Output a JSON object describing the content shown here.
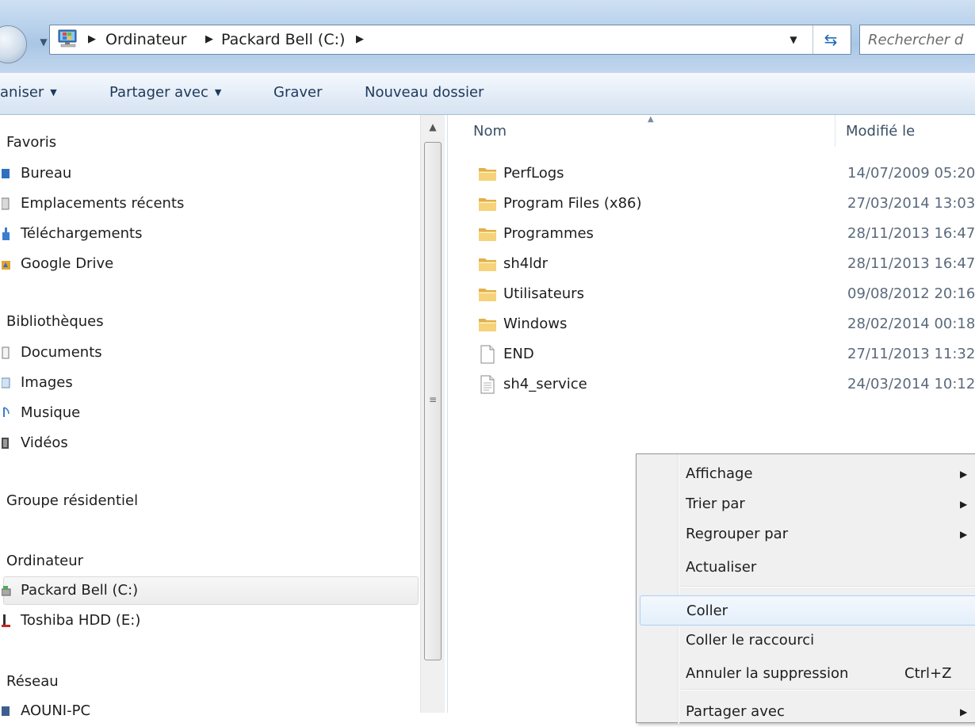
{
  "address_bar": {
    "crumbs": [
      "Ordinateur",
      "Packard Bell (C:)"
    ],
    "search_placeholder": "Rechercher d"
  },
  "toolbar": {
    "organize_label": "aniser",
    "share_label": "Partager avec",
    "burn_label": "Graver",
    "new_folder_label": "Nouveau dossier"
  },
  "nav": {
    "favorites_title": "Favoris",
    "favorites": [
      "Bureau",
      "Emplacements récents",
      "Téléchargements",
      "Google Drive"
    ],
    "libraries_title": "Bibliothèques",
    "libraries": [
      "Documents",
      "Images",
      "Musique",
      "Vidéos"
    ],
    "homegroup_title": "Groupe résidentiel",
    "computer_title": "Ordinateur",
    "drives": [
      "Packard Bell (C:)",
      "Toshiba HDD (E:)"
    ],
    "network_title": "Réseau",
    "network_items": [
      "AOUNI-PC"
    ]
  },
  "columns": {
    "name": "Nom",
    "modified": "Modifié le"
  },
  "files": [
    {
      "name": "PerfLogs",
      "date": "14/07/2009 05:20",
      "type": "folder"
    },
    {
      "name": "Program Files (x86)",
      "date": "27/03/2014 13:03",
      "type": "folder"
    },
    {
      "name": "Programmes",
      "date": "28/11/2013 16:47",
      "type": "folder"
    },
    {
      "name": "sh4ldr",
      "date": "28/11/2013 16:47",
      "type": "folder"
    },
    {
      "name": "Utilisateurs",
      "date": "09/08/2012 20:16",
      "type": "folder"
    },
    {
      "name": "Windows",
      "date": "28/02/2014 00:18",
      "type": "folder"
    },
    {
      "name": "END",
      "date": "27/11/2013 11:32",
      "type": "file"
    },
    {
      "name": "sh4_service",
      "date": "24/03/2014 10:12",
      "type": "textfile"
    }
  ],
  "context_menu": {
    "items": [
      {
        "label": "Affichage",
        "submenu": true
      },
      {
        "label": "Trier par",
        "submenu": true
      },
      {
        "label": "Regrouper par",
        "submenu": true
      },
      {
        "label": "Actualiser"
      },
      {
        "label": "Coller",
        "hover": true
      },
      {
        "label": "Coller le raccourci"
      },
      {
        "label": "Annuler la suppression",
        "shortcut": "Ctrl+Z"
      },
      {
        "label": "Partager avec",
        "submenu": true
      }
    ]
  },
  "colors": {
    "accent": "#1e395b",
    "selection": "#e4effb",
    "menu_bg": "#f0f0f0"
  }
}
